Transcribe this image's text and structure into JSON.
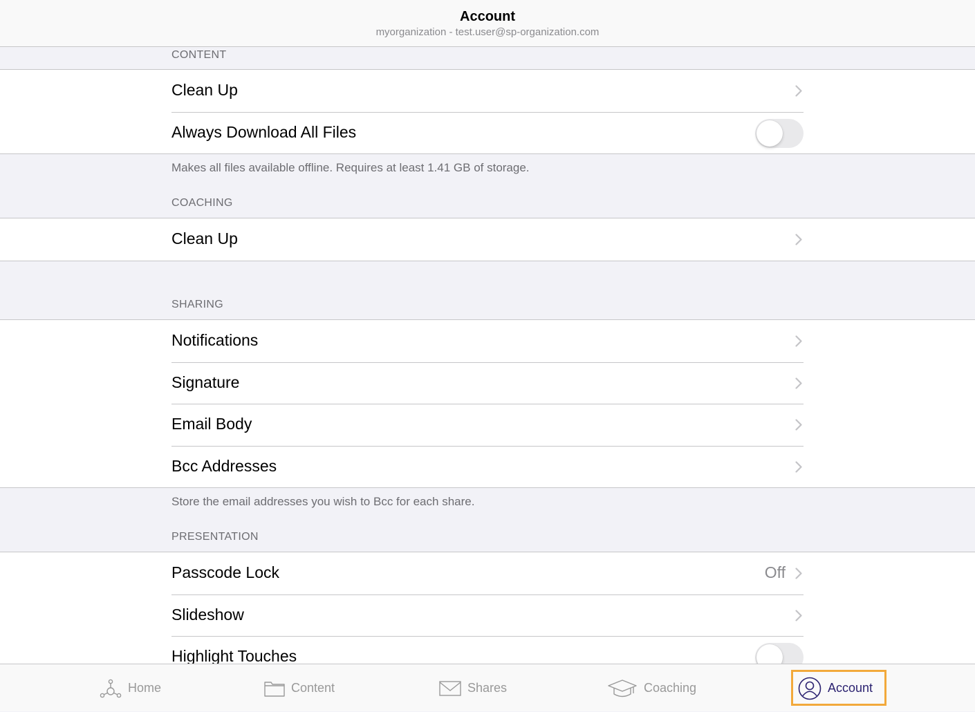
{
  "nav": {
    "title": "Account",
    "subtitle": "myorganization - test.user@sp-organization.com"
  },
  "sections": {
    "content": {
      "header": "CONTENT",
      "rows": {
        "clean_up": "Clean Up",
        "always_download": "Always Download All Files"
      },
      "always_download_on": false,
      "footer": "Makes all files available offline. Requires at least 1.41 GB of storage."
    },
    "coaching": {
      "header": "COACHING",
      "rows": {
        "clean_up": "Clean Up"
      }
    },
    "sharing": {
      "header": "SHARING",
      "rows": {
        "notifications": "Notifications",
        "signature": "Signature",
        "email_body": "Email Body",
        "bcc_addresses": "Bcc Addresses"
      },
      "footer": "Store the email addresses you wish to Bcc for each share."
    },
    "presentation": {
      "header": "PRESENTATION",
      "rows": {
        "passcode_lock": "Passcode Lock",
        "passcode_lock_value": "Off",
        "slideshow": "Slideshow",
        "highlight_touches": "Highlight Touches"
      },
      "highlight_touches_on": false
    }
  },
  "tabs": {
    "home": {
      "label": "Home",
      "icon": "home-network-icon"
    },
    "content": {
      "label": "Content",
      "icon": "folder-icon"
    },
    "shares": {
      "label": "Shares",
      "icon": "envelope-icon"
    },
    "coaching": {
      "label": "Coaching",
      "icon": "graduation-cap-icon"
    },
    "account": {
      "label": "Account",
      "icon": "user-circle-icon",
      "selected": true
    }
  },
  "colors": {
    "accent": "#2b2270",
    "highlight_border": "#f2a93b",
    "background": "#f2f2f7"
  }
}
